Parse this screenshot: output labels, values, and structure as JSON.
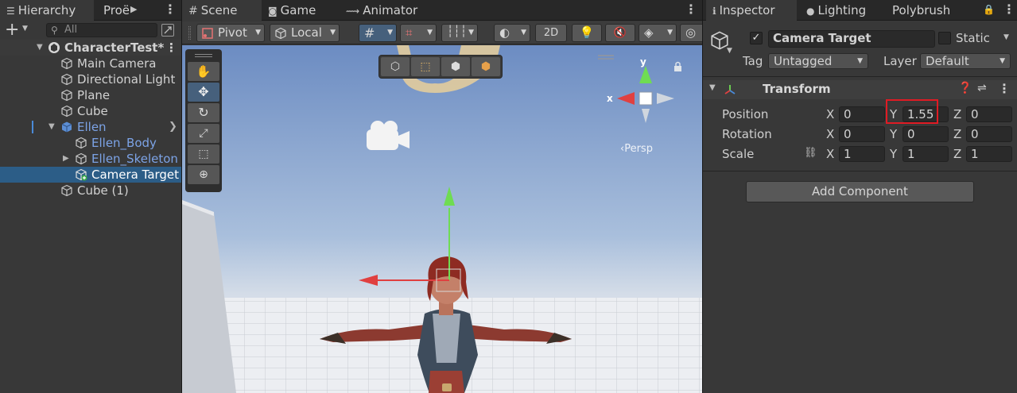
{
  "hierarchy": {
    "tab_label": "Hierarchy",
    "tab2_label": "Proё",
    "search_placeholder": "All",
    "scene_name": "CharacterTest*",
    "items": [
      {
        "label": "Main Camera"
      },
      {
        "label": "Directional Light"
      },
      {
        "label": "Plane"
      },
      {
        "label": "Cube"
      },
      {
        "label": "Ellen"
      },
      {
        "label": "Ellen_Body"
      },
      {
        "label": "Ellen_Skeleton"
      },
      {
        "label": "Camera Target"
      },
      {
        "label": "Cube (1)"
      }
    ]
  },
  "scene": {
    "tabs": [
      "Scene",
      "Game",
      "Animator"
    ],
    "toolbar": {
      "pivot": "Pivot",
      "local": "Local",
      "mode_2d": "2D"
    },
    "persp_label": "‹Persp",
    "gizmo_y": "y",
    "gizmo_x": "x"
  },
  "inspector": {
    "tabs": [
      "Inspector",
      "Lighting",
      "Polybrush"
    ],
    "object_name": "Camera Target",
    "active": true,
    "static_label": "Static",
    "static": false,
    "tag_label": "Tag",
    "tag_value": "Untagged",
    "layer_label": "Layer",
    "layer_value": "Default",
    "transform": {
      "title": "Transform",
      "position_label": "Position",
      "rotation_label": "Rotation",
      "scale_label": "Scale",
      "axes": [
        "X",
        "Y",
        "Z"
      ],
      "position": [
        "0",
        "1.55",
        "0"
      ],
      "rotation": [
        "0",
        "0",
        "0"
      ],
      "scale": [
        "1",
        "1",
        "1"
      ]
    },
    "add_component": "Add Component",
    "highlight_color": "#e01b24"
  }
}
